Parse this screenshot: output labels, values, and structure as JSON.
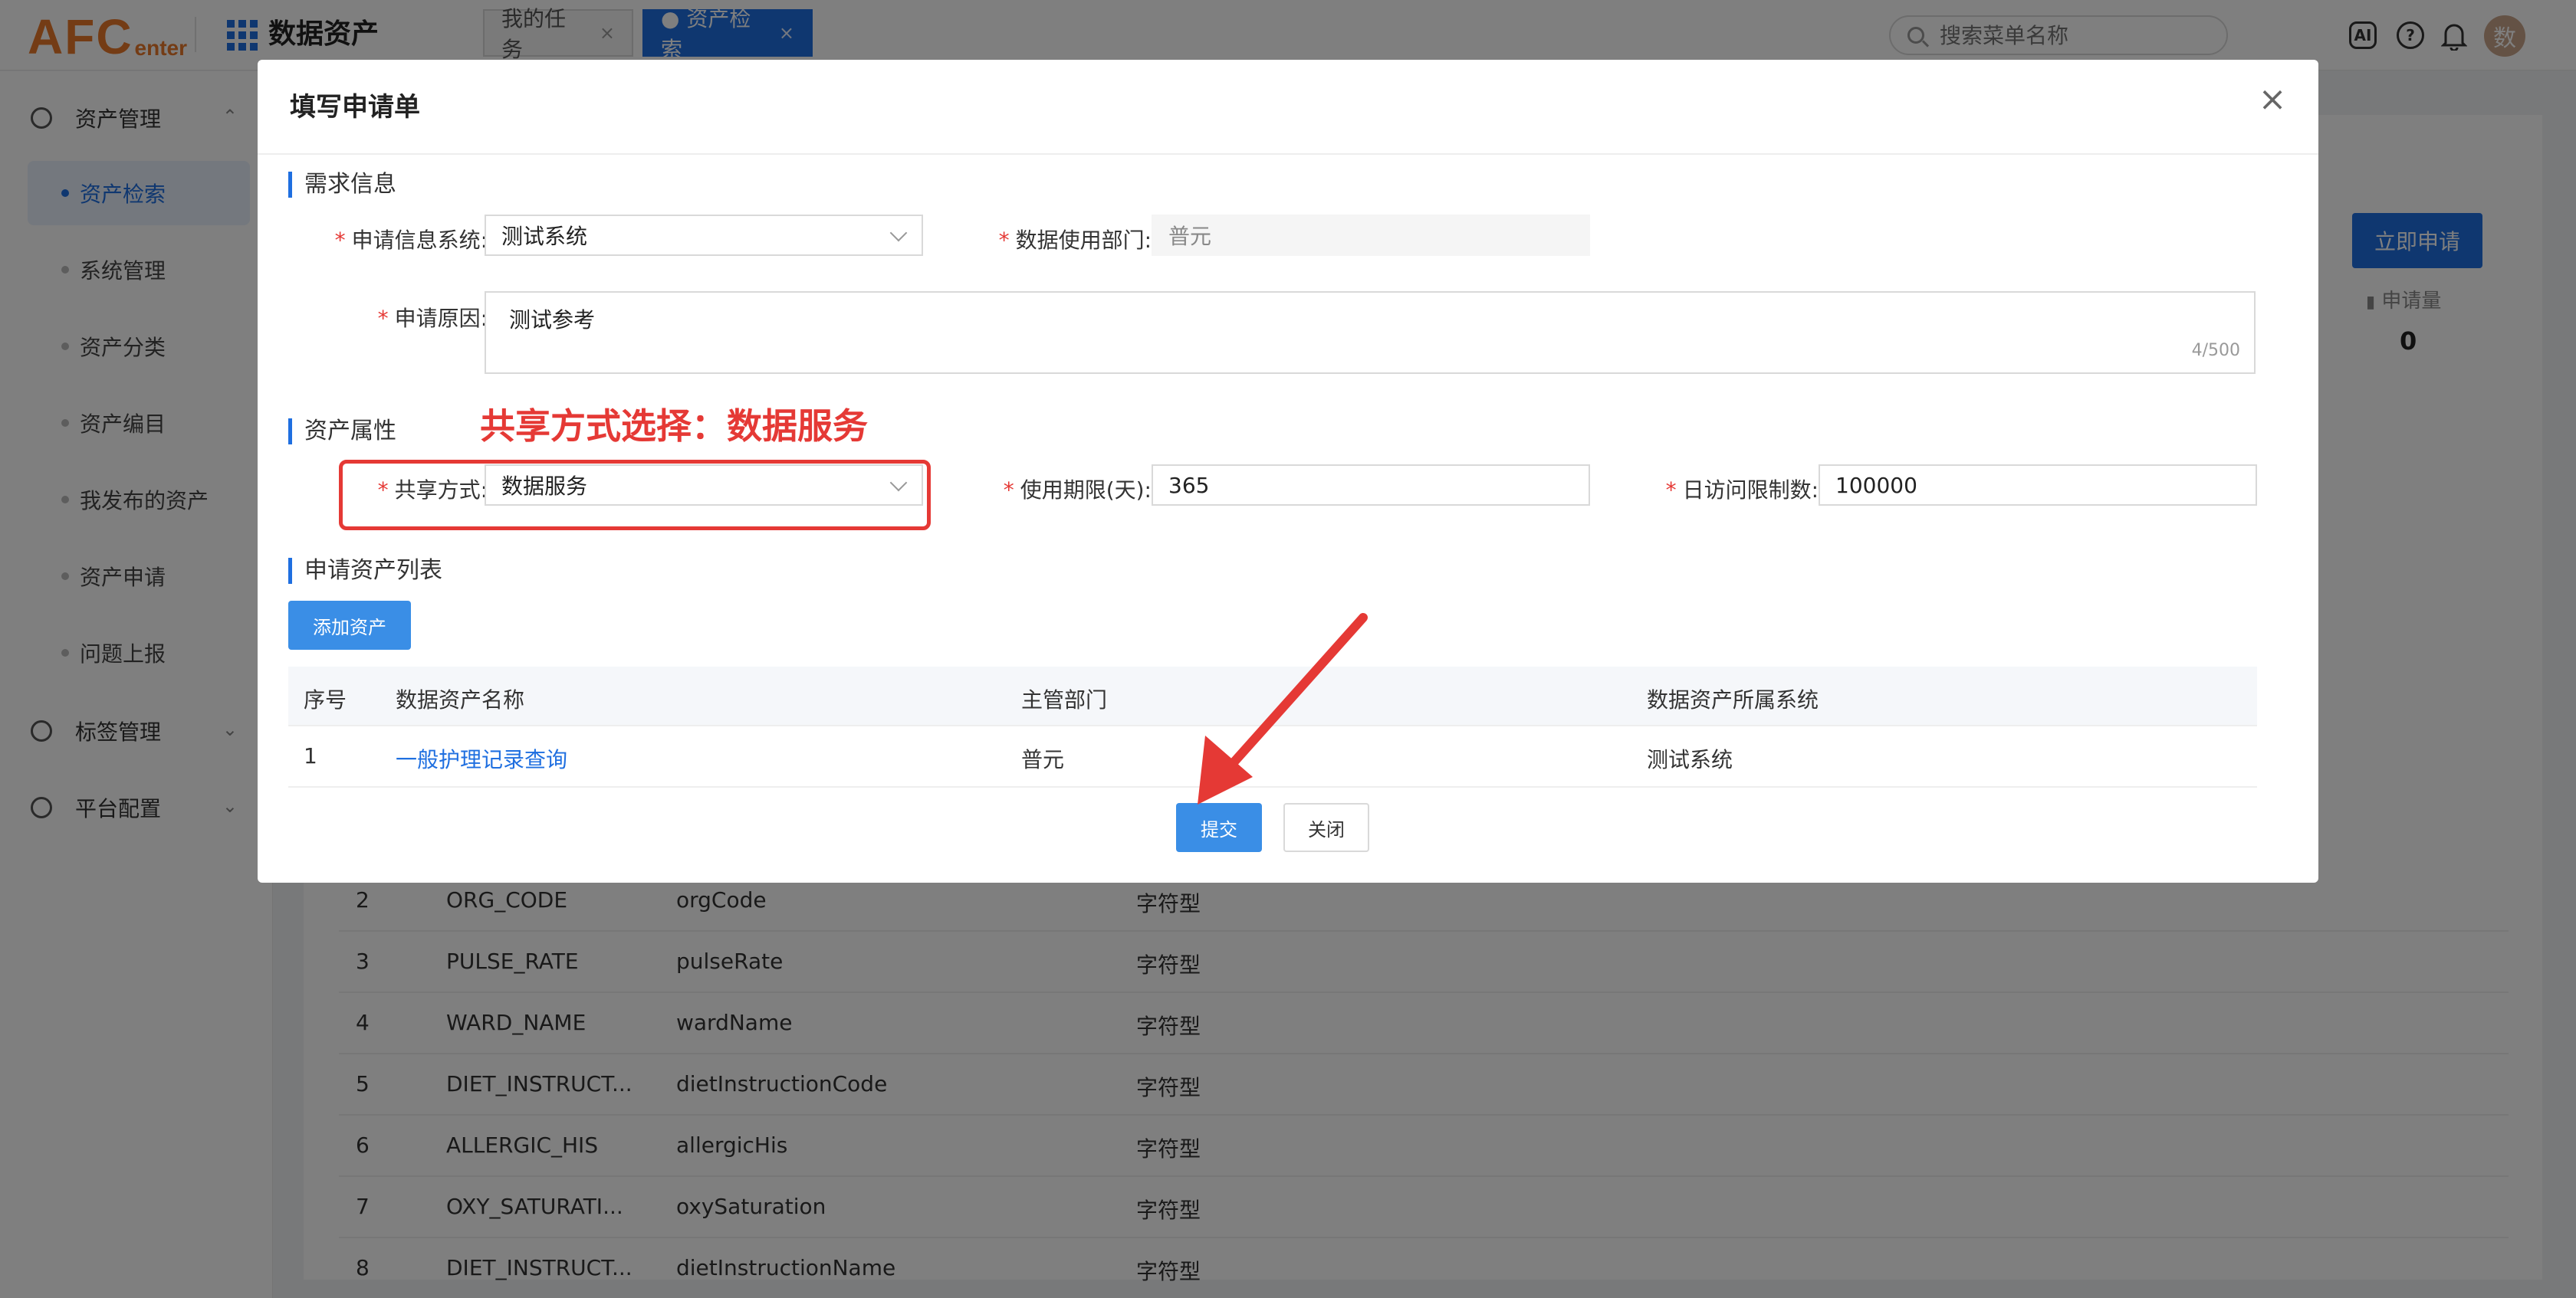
{
  "header": {
    "logo_main": "AFC",
    "logo_sub": "enter",
    "app_title": "数据资产",
    "tabs": [
      {
        "label": "我的任务",
        "close": "×"
      },
      {
        "label": "● 资产检索",
        "close": "×"
      }
    ],
    "search_placeholder": "搜索菜单名称",
    "icons": {
      "ai": "AI",
      "help": "?"
    },
    "avatar": "数"
  },
  "sidebar": {
    "group_asset_mgmt": "资产管理",
    "items": [
      "资产检索",
      "系统管理",
      "资产分类",
      "资产编目",
      "我发布的资产",
      "资产申请",
      "问题上报"
    ],
    "group_tag_mgmt": "标签管理",
    "group_platform": "平台配置",
    "expand_glyph": "⌃",
    "collapse_glyph": "⌄"
  },
  "background": {
    "apply_now": "立即申请",
    "apply_count_label": "申请量",
    "apply_count": "0",
    "rows": [
      {
        "no": "2",
        "code": "ORG_CODE",
        "field": "orgCode",
        "type": "字符型"
      },
      {
        "no": "3",
        "code": "PULSE_RATE",
        "field": "pulseRate",
        "type": "字符型"
      },
      {
        "no": "4",
        "code": "WARD_NAME",
        "field": "wardName",
        "type": "字符型"
      },
      {
        "no": "5",
        "code": "DIET_INSTRUCT...",
        "field": "dietInstructionCode",
        "type": "字符型"
      },
      {
        "no": "6",
        "code": "ALLERGIC_HIS",
        "field": "allergicHis",
        "type": "字符型"
      },
      {
        "no": "7",
        "code": "OXY_SATURATI...",
        "field": "oxySaturation",
        "type": "字符型"
      },
      {
        "no": "8",
        "code": "DIET_INSTRUCT...",
        "field": "dietInstructionName",
        "type": "字符型"
      }
    ]
  },
  "modal": {
    "title": "填写申请单",
    "close": "×",
    "section_requirements": "需求信息",
    "label_system": "申请信息系统:",
    "value_system": "测试系统",
    "label_dept": "数据使用部门:",
    "value_dept": "普元",
    "label_reason": "申请原因:",
    "value_reason": "测试参考",
    "reason_counter": "4/500",
    "section_attributes": "资产属性",
    "annotation": "共享方式选择：数据服务",
    "label_share": "共享方式:",
    "value_share": "数据服务",
    "label_period": "使用期限(天):",
    "value_period": "365",
    "label_limit": "日访问限制数:",
    "value_limit": "100000",
    "section_list": "申请资产列表",
    "add_asset": "添加资产",
    "table_headers": [
      "序号",
      "数据资产名称",
      "主管部门",
      "数据资产所属系统"
    ],
    "table_rows": [
      {
        "no": "1",
        "name": "一般护理记录查询",
        "dept": "普元",
        "system": "测试系统"
      }
    ],
    "submit": "提交",
    "close_button": "关闭"
  },
  "colors": {
    "accent": "#1f6fe0",
    "annotation": "#e53935",
    "logo": "#e8782a"
  }
}
